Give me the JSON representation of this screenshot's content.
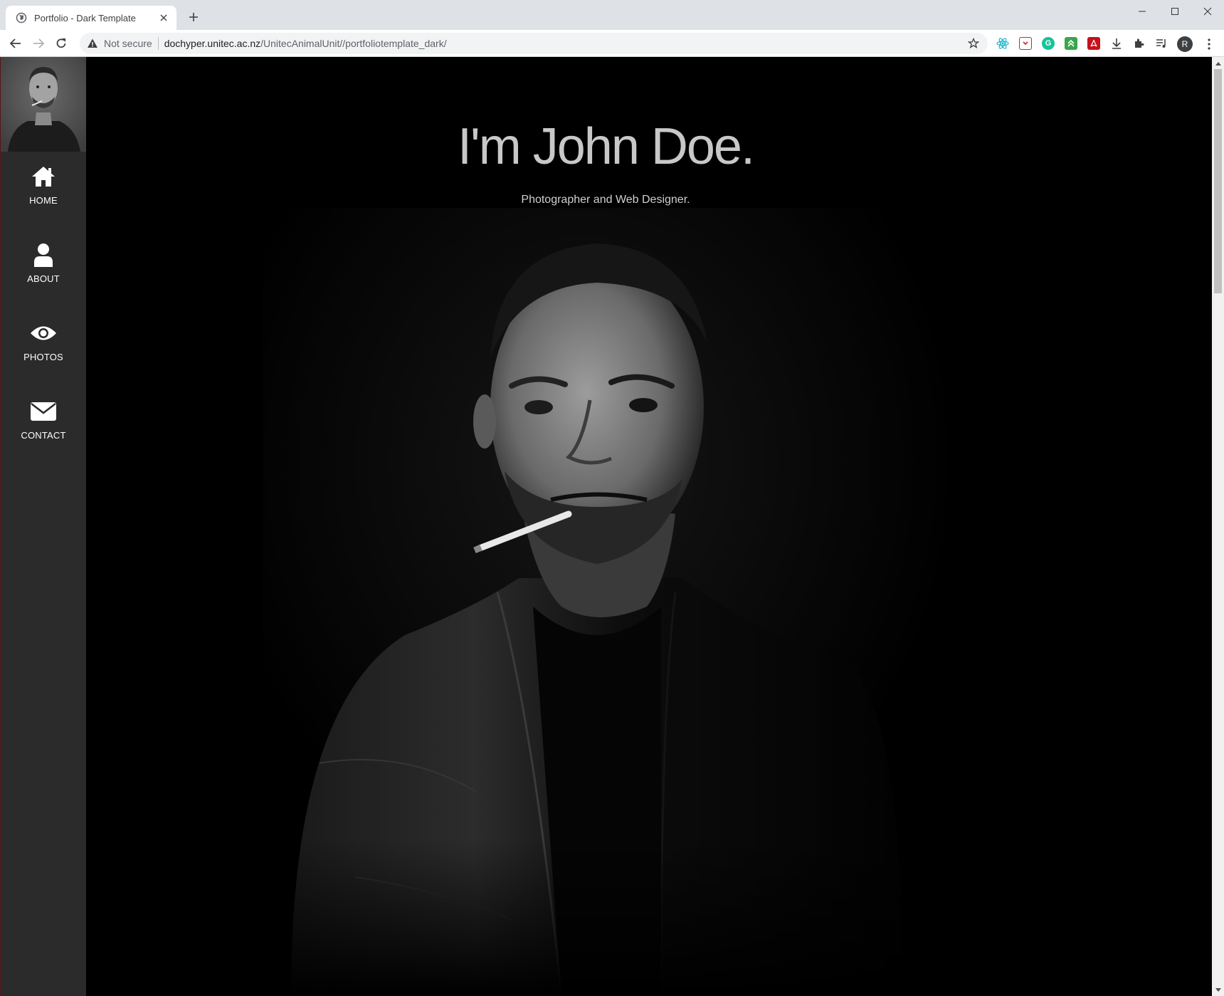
{
  "browser": {
    "tab_title": "Portfolio - Dark Template",
    "security_label": "Not secure",
    "url_host": "dochyper.unitec.ac.nz",
    "url_path": "/UnitecAnimalUnit//portfoliotemplate_dark/",
    "profile_initial": "R"
  },
  "sidebar": {
    "items": [
      {
        "label": "HOME",
        "icon": "home-icon"
      },
      {
        "label": "ABOUT",
        "icon": "user-icon"
      },
      {
        "label": "PHOTOS",
        "icon": "eye-icon"
      },
      {
        "label": "CONTACT",
        "icon": "envelope-icon"
      }
    ]
  },
  "hero": {
    "title": "I'm John Doe.",
    "subtitle": "Photographer and Web Designer."
  },
  "colors": {
    "sidebar_bg": "#2b2b2b",
    "page_bg": "#000000",
    "title_color": "#c8c8c8"
  }
}
